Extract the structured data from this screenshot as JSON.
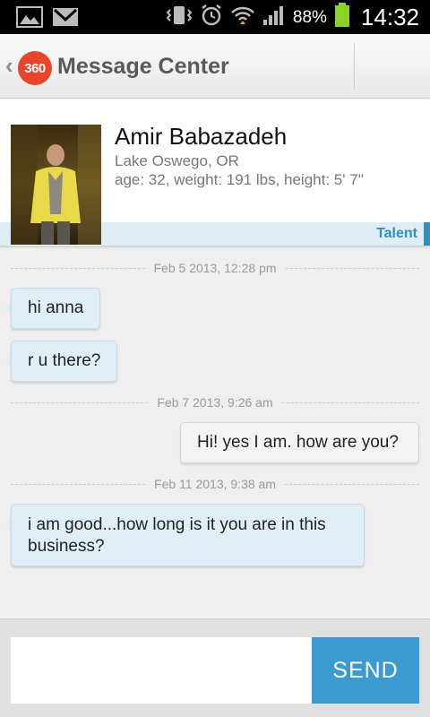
{
  "status_bar": {
    "battery_percent": "88%",
    "time": "14:32",
    "icons": [
      "gallery-icon",
      "gmail-icon",
      "vibrate-icon",
      "alarm-icon",
      "wifi-icon",
      "signal-icon",
      "battery-icon"
    ]
  },
  "action_bar": {
    "logo_text": "360",
    "title": "Message Center"
  },
  "profile": {
    "name": "Amir Babazadeh",
    "location": "Lake Oswego, OR",
    "stats": "age: 32, weight: 191 lbs, height: 5' 7''",
    "badge": "Talent"
  },
  "conversation": {
    "date_separators": [
      "Feb 5 2013, 12:28 pm",
      "Feb 7 2013, 9:26 am",
      "Feb 11 2013, 9:38 am"
    ],
    "messages": [
      {
        "direction": "incoming",
        "text": "hi anna"
      },
      {
        "direction": "incoming",
        "text": "r u there?"
      },
      {
        "direction": "outgoing",
        "text": "Hi! yes I am. how are you?"
      },
      {
        "direction": "incoming",
        "text": "i am good...how long is it you are in this business?"
      }
    ]
  },
  "composer": {
    "input_value": "",
    "send_label": "SEND"
  },
  "colors": {
    "brand": "#e8452b",
    "accent": "#3b9ad0",
    "incoming_bubble": "#dfeef7"
  }
}
